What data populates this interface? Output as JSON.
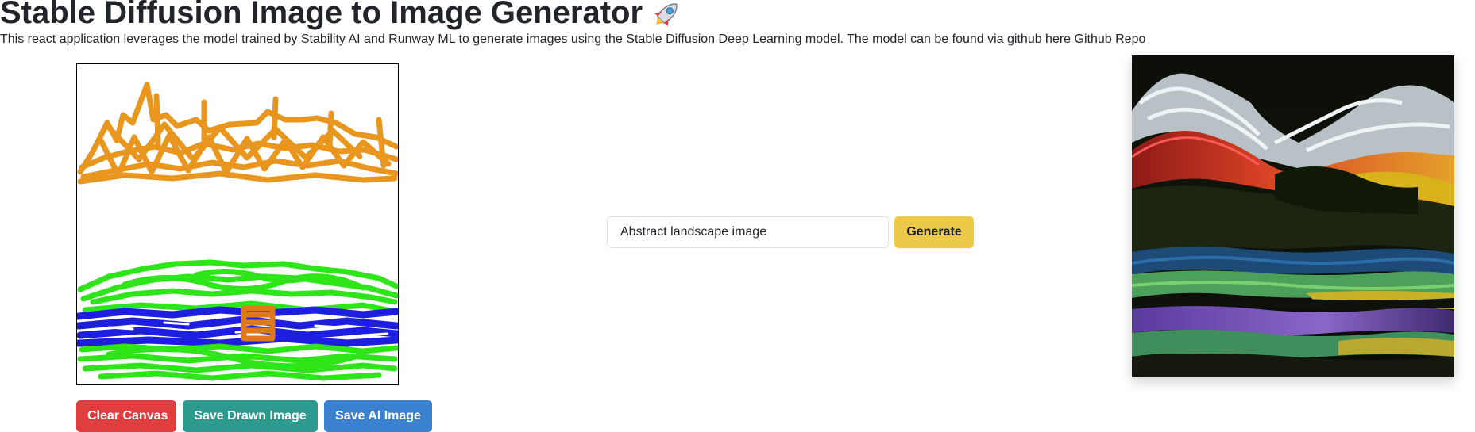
{
  "header": {
    "title": "Stable Diffusion Image to Image Generator",
    "title_icon": "rocket-emoji",
    "description": "This react application leverages the model trained by Stability AI and Runway ML to generate images using the Stable Diffusion Deep Learning model. The model can be found via github here",
    "repo_link_label": "Github Repo"
  },
  "canvas": {
    "actions": {
      "clear_label": "Clear Canvas",
      "save_drawn_label": "Save Drawn Image",
      "save_ai_label": "Save AI Image"
    }
  },
  "prompt": {
    "value": "Abstract landscape image",
    "generate_label": "Generate"
  },
  "colors": {
    "clear_button": "#e03e3e",
    "save_drawn_button": "#2c9a8f",
    "save_ai_button": "#3a82d0",
    "generate_button": "#ecc94b",
    "brush_orange": "#e8961e",
    "brush_green": "#2ee51a",
    "brush_blue": "#1e1ee0",
    "brush_dark_orange": "#e07a18"
  }
}
